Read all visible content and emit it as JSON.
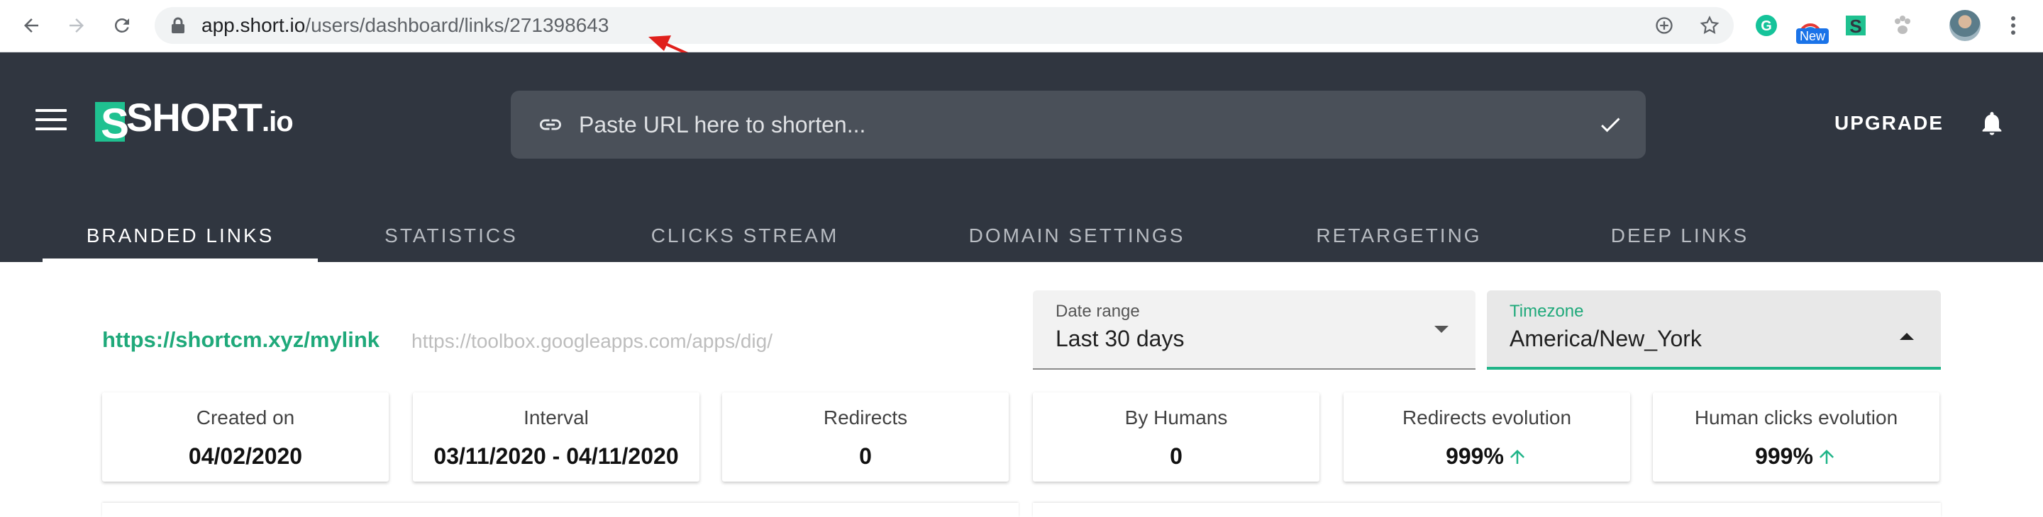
{
  "browser": {
    "url_host": "app.short.io",
    "url_path": "/users/dashboard/links/271398643",
    "extension_badge": "New"
  },
  "app": {
    "logo_main": "SHORT",
    "logo_suffix": ".io",
    "shorten_placeholder": "Paste URL here to shorten...",
    "upgrade_label": "UPGRADE",
    "tabs": [
      {
        "label": "BRANDED LINKS",
        "active": true
      },
      {
        "label": "STATISTICS",
        "active": false
      },
      {
        "label": "CLICKS STREAM",
        "active": false
      },
      {
        "label": "DOMAIN SETTINGS",
        "active": false
      },
      {
        "label": "RETARGETING",
        "active": false
      },
      {
        "label": "DEEP LINKS",
        "active": false
      }
    ]
  },
  "link": {
    "short_url": "https://shortcm.xyz/mylink",
    "original_url": "https://toolbox.googleapps.com/apps/dig/"
  },
  "filters": {
    "date_range": {
      "label": "Date range",
      "value": "Last 30 days"
    },
    "timezone": {
      "label": "Timezone",
      "value": "America/New_York"
    }
  },
  "stats": [
    {
      "title": "Created on",
      "value": "04/02/2020"
    },
    {
      "title": "Interval",
      "value": "03/11/2020 - 04/11/2020"
    },
    {
      "title": "Redirects",
      "value": "0"
    },
    {
      "title": "By Humans",
      "value": "0"
    },
    {
      "title": "Redirects evolution",
      "value": "999%"
    },
    {
      "title": "Human clicks evolution",
      "value": "999%"
    }
  ],
  "colors": {
    "header_bg": "#303640",
    "accent_green": "#1fa97a",
    "annotation_red": "#e0201c"
  }
}
